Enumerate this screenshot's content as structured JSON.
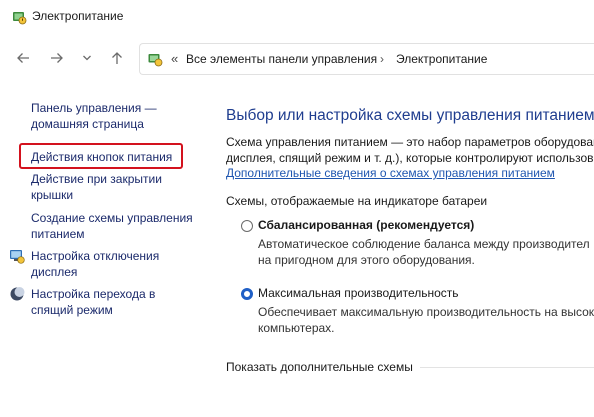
{
  "window": {
    "title": "Электропитание"
  },
  "address": {
    "separator": "«",
    "crumbs": [
      "Все элементы панели управления",
      "Электропитание"
    ],
    "chevron": "›"
  },
  "sidebar": {
    "home": [
      "Панель управления —",
      "домашняя страница"
    ],
    "items": [
      {
        "lines": [
          "Действия кнопок питания"
        ]
      },
      {
        "lines": [
          "Действие при закрытии",
          "крышки"
        ]
      },
      {
        "lines": [
          "Создание схемы управления",
          "питанием"
        ]
      },
      {
        "lines": [
          "Настройка отключения",
          "дисплея"
        ],
        "icon": "display-power-icon"
      },
      {
        "lines": [
          "Настройка перехода в",
          "спящий режим"
        ],
        "icon": "sleep-moon-icon"
      }
    ]
  },
  "main": {
    "title": "Выбор или настройка схемы управления питанием",
    "desc_line1": "Схема управления питанием — это набор параметров оборудован",
    "desc_line2": "дисплея, спящий режим и т. д.), которые контролируют использов",
    "more_link": "Дополнительные сведения о схемах управления питанием",
    "schemes_header": "Схемы, отображаемые на индикаторе батареи",
    "plans": [
      {
        "name": "Сбалансированная (рекомендуется)",
        "bold": true,
        "checked": false,
        "desc": [
          "Автоматическое соблюдение баланса между производител",
          "на пригодном для этого оборудования."
        ]
      },
      {
        "name": "Максимальная производительность",
        "bold": false,
        "checked": true,
        "desc": [
          "Обеспечивает максимальную производительность на высок",
          "компьютерах."
        ]
      }
    ],
    "show_more": "Показать дополнительные схемы"
  }
}
